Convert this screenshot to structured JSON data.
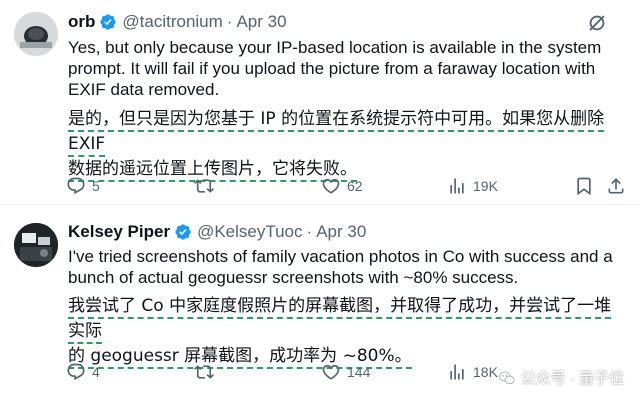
{
  "colors": {
    "verified": "#1d9bf0",
    "secondary_text": "#536471",
    "translation_underline": "#27a061"
  },
  "tweets": [
    {
      "author": {
        "name": "orb",
        "handle": "@tacitronium",
        "separator": "·",
        "time": "Apr 30",
        "avatar_icon": "avatar-image"
      },
      "text_en": "Yes, but only because your IP-based location is available in the system prompt. It will fail if you upload the picture from a faraway location with EXIF data removed.",
      "text_zh_lines": [
        "是的，但只是因为您基于 IP 的位置在系统提示符中可用。如果您从删除 EXIF",
        "数据的遥远位置上传图片，它将失败。"
      ],
      "actions": {
        "replies": "5",
        "retweets": "",
        "likes": "62",
        "views": "19K"
      }
    },
    {
      "author": {
        "name": "Kelsey Piper",
        "handle": "@KelseyTuoc",
        "separator": "·",
        "time": "Apr 30",
        "avatar_icon": "avatar-image"
      },
      "text_en": "I've tried screenshots of family vacation photos in Co with success and a bunch of actual geoguessr screenshots with ~80% success.",
      "text_zh_lines": [
        "我尝试了 Co 中家庭度假照片的屏幕截图，并取得了成功，并尝试了一堆实际",
        "的 geoguessr 屏幕截图，成功率为 ~80%。"
      ],
      "actions": {
        "replies": "4",
        "retweets": "",
        "likes": "144",
        "views": "18K"
      }
    }
  ],
  "watermark": {
    "text": "公众号 · 量子位",
    "icon": "wechat-icon"
  }
}
